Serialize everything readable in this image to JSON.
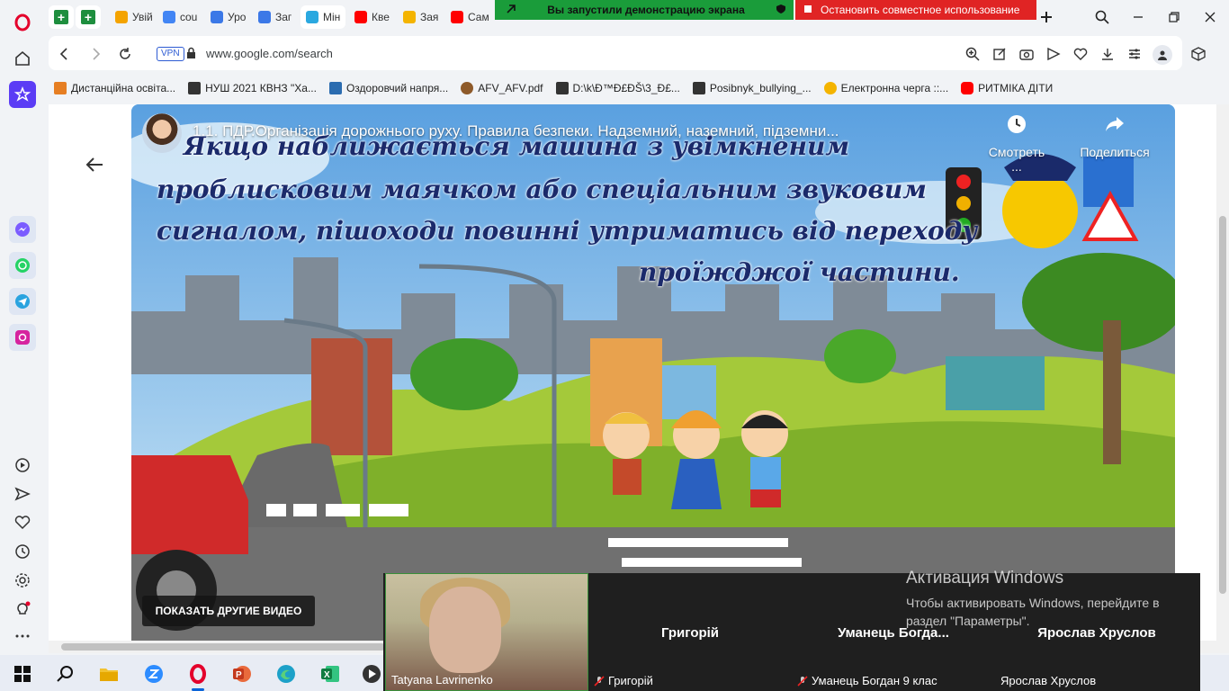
{
  "browser": {
    "tabs": [
      {
        "label": "Увій",
        "color": "#f4a300"
      },
      {
        "label": "cou",
        "color": "#4285f4"
      },
      {
        "label": "Уро",
        "color": "#3b78e7"
      },
      {
        "label": "Заг",
        "color": "#3b78e7"
      },
      {
        "label": "Мін",
        "color": "#2aa8e0"
      },
      {
        "label": "Кве",
        "color": "#ff0000"
      },
      {
        "label": "Зая",
        "color": "#f4b400"
      },
      {
        "label": "Сам",
        "color": "#ff0000"
      }
    ],
    "share_notice": "Вы запустили демонстрацию экрана",
    "stop_sharing": "Остановить совместное использование",
    "vpn_label": "VPN",
    "url": "www.google.com/search"
  },
  "bookmarks": [
    {
      "label": "Дистанційна освіта...",
      "color": "#e67e22"
    },
    {
      "label": "НУШ 2021 КВНЗ \"Ха...",
      "color": "#333333"
    },
    {
      "label": "Оздоровчий напря...",
      "color": "#2b6cb0"
    },
    {
      "label": "AFV_AFV.pdf",
      "color": "#8e5a2a"
    },
    {
      "label": "D:\\k\\Đ™Đ£ĐŠ\\3_Đ£...",
      "color": "#333333"
    },
    {
      "label": "Posibnyk_bullying_...",
      "color": "#333333"
    },
    {
      "label": "Електронна черга ::...",
      "color": "#f4b400"
    },
    {
      "label": "РИТМІКА ДІТИ",
      "color": "#ff0000"
    }
  ],
  "video": {
    "title": "1.1. ПДР.Організація дорожнього руху. Правила безпеки. Надземний, наземний, підземни...",
    "watch_later": "Смотреть ...",
    "share": "Поделиться",
    "slide_lines": [
      "Якщо наближається машина з увімкненим",
      "проблисковим маячком або спеціальним звуковим",
      "сигналом, пішоходи повинні утриматись від переходу",
      "проїжджої частини."
    ],
    "more_videos": "ПОКАЗАТЬ ДРУГИЕ ВИДЕО"
  },
  "conference": {
    "participants": [
      {
        "name": "Tatyana Lavrinenko",
        "display": ""
      },
      {
        "name": "Григорій",
        "display": "Григорій"
      },
      {
        "name": "Уманець Богдан 9 клас",
        "display": "Уманець  Богда..."
      },
      {
        "name": "Ярослав Хруслов",
        "display": "Ярослав Хруслов"
      }
    ]
  },
  "activation": {
    "title": "Активация Windows",
    "text": "Чтобы активировать Windows, перейдите в раздел \"Параметры\"."
  },
  "colors": {
    "opera_red": "#e4002b",
    "sidebar_active": "#5b3cf5",
    "share_green": "#1a9c3a",
    "share_red": "#e02424"
  }
}
